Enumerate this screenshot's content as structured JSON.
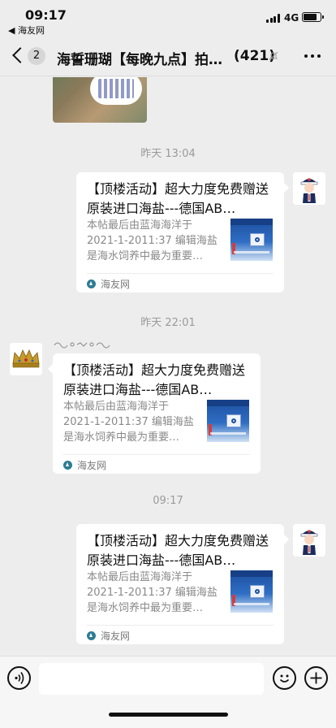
{
  "status_bar": {
    "time": "09:17",
    "back_app": "◀ 海友网",
    "network": "4G"
  },
  "nav": {
    "unread_count": "2",
    "title": "海誓珊瑚【每晚九点】拍…",
    "member_count": "(421)"
  },
  "messages": [
    {
      "timestamp": "昨天 13:04",
      "side": "right",
      "card": {
        "title": "【顶楼活动】超大力度免费赠送原装进口海盐---德国AB…",
        "desc": "本帖最后由蓝海海洋于 2021-1-2011:37 编辑海盐是海水饲养中最为重要…",
        "source": "海友网"
      }
    },
    {
      "timestamp": "昨天 22:01",
      "side": "left",
      "card": {
        "title": "【顶楼活动】超大力度免费赠送原装进口海盐---德国AB…",
        "desc": "本帖最后由蓝海海洋于 2021-1-2011:37 编辑海盐是海水饲养中最为重要…",
        "source": "海友网"
      }
    },
    {
      "timestamp": "09:17",
      "side": "right",
      "card": {
        "title": "【顶楼活动】超大力度免费赠送原装进口海盐---德国AB…",
        "desc": "本帖最后由蓝海海洋于 2021-1-2011:37 编辑海盐是海水饲养中最为重要…",
        "source": "海友网"
      }
    }
  ],
  "input_bar": {
    "icons": [
      "voice-icon",
      "emoji-icon",
      "plus-icon"
    ]
  }
}
